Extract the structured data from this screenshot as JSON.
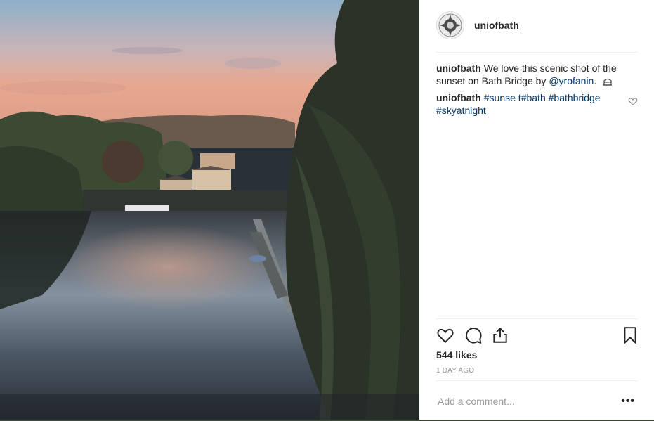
{
  "post": {
    "username": "uniofbath",
    "caption": {
      "user": "uniofbath",
      "text": "We love this scenic shot of the sunset on Bath Bridge by",
      "mention": "@yrofanin",
      "suffix": ".",
      "emoji_icon": "ring-emoji-icon"
    },
    "comment": {
      "user": "uniofbath",
      "tags": [
        "#sunse t",
        "#bath",
        "#bathbridge",
        "#skyatnight"
      ]
    },
    "likes": "544 likes",
    "time": "1 DAY AGO",
    "add_comment_placeholder": "Add a comment...",
    "more_label": "•••"
  },
  "icons": {
    "like": "heart-icon",
    "comment": "comment-bubble-icon",
    "share": "share-icon",
    "save": "bookmark-icon",
    "comment_like": "heart-small-icon"
  },
  "colors": {
    "link": "#003569",
    "text": "#262626",
    "muted": "#999999",
    "divider": "#efefef"
  }
}
